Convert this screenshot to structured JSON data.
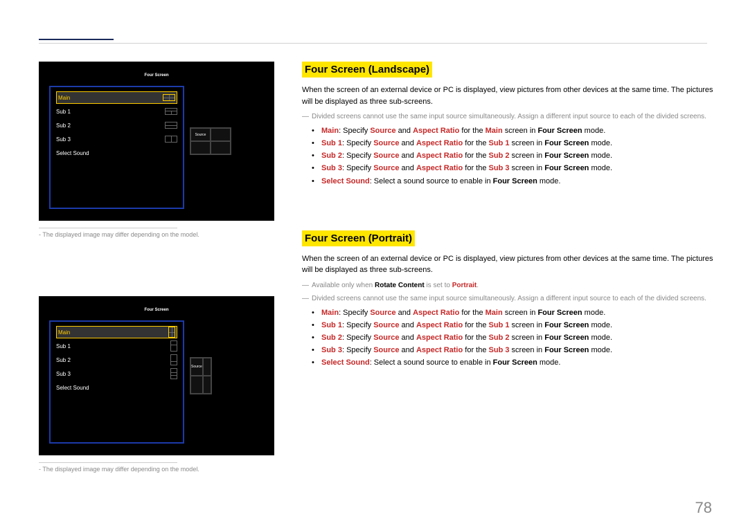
{
  "pageNumber": "78",
  "caption": "The displayed image may differ depending on the model.",
  "osd": {
    "tabActive": "Four Screen",
    "tabActive2": "Four Screen",
    "rows": {
      "landscape": [
        {
          "label": "Main",
          "sel": true,
          "glyph": "four-land"
        },
        {
          "label": "Sub 1",
          "glyph": "gL1"
        },
        {
          "label": "Sub 2",
          "glyph": "gL2"
        },
        {
          "label": "Sub 3",
          "glyph": "gL3"
        },
        {
          "label": "Select Sound",
          "value": ""
        }
      ],
      "portrait": [
        {
          "label": "Main",
          "sel": true,
          "glyph": "four-port-sel",
          "portrait": true
        },
        {
          "label": "Sub 1",
          "glyph": "gP1",
          "portrait": true
        },
        {
          "label": "Sub 2",
          "glyph": "gP2",
          "portrait": true
        },
        {
          "label": "Sub 3",
          "glyph": "gP3",
          "portrait": true
        },
        {
          "label": "Select Sound",
          "value": ""
        }
      ]
    },
    "previewLabel": "Source"
  },
  "section1": {
    "title": "Four Screen (Landscape)",
    "intro": "When the screen of an external device or PC is displayed, view pictures from other devices at the same time. The pictures will be displayed as three sub-screens.",
    "note1": "Divided screens cannot use the same input source simultaneously. Assign a different input source to each of the divided screens.",
    "bullets": [
      {
        "lead": "Main",
        "t1": ": Specify ",
        "b1": "Source",
        "t2": " and ",
        "b2": "Aspect Ratio",
        "t3": " for the ",
        "b3": "Main",
        "t4": " screen in ",
        "b4": "Four Screen",
        "t5": " mode."
      },
      {
        "lead": "Sub 1",
        "t1": ": Specify ",
        "b1": "Source",
        "t2": " and ",
        "b2": "Aspect Ratio",
        "t3": " for the ",
        "b3": "Sub 1",
        "t4": " screen in ",
        "b4": "Four Screen",
        "t5": " mode."
      },
      {
        "lead": "Sub 2",
        "t1": ": Specify ",
        "b1": "Source",
        "t2": " and ",
        "b2": "Aspect Ratio",
        "t3": " for the ",
        "b3": "Sub 2",
        "t4": " screen in ",
        "b4": "Four Screen",
        "t5": " mode."
      },
      {
        "lead": "Sub 3",
        "t1": ": Specify ",
        "b1": "Source",
        "t2": " and ",
        "b2": "Aspect Ratio",
        "t3": " for the ",
        "b3": "Sub 3",
        "t4": " screen in ",
        "b4": "Four Screen",
        "t5": " mode."
      },
      {
        "lead": "Select Sound",
        "t1": ": Select a sound source to enable in ",
        "b1": "Four Screen",
        "t2": " mode."
      }
    ]
  },
  "section2": {
    "title": "Four Screen (Portrait)",
    "intro": "When the screen of an external device or PC is displayed, view pictures from other devices at the same time. The pictures will be displayed as three sub-screens.",
    "noteA_pre": "Available only when ",
    "noteA_b1": "Rotate Content",
    "noteA_mid": " is set to ",
    "noteA_b2": "Portrait",
    "noteA_suf": ".",
    "note1": "Divided screens cannot use the same input source simultaneously. Assign a different input source to each of the divided screens.",
    "bullets": [
      {
        "lead": "Main",
        "t1": ": Specify ",
        "b1": "Source",
        "t2": " and ",
        "b2": "Aspect Ratio",
        "t3": " for the ",
        "b3": "Main",
        "t4": " screen in ",
        "b4": "Four Screen",
        "t5": " mode."
      },
      {
        "lead": "Sub 1",
        "t1": ": Specify ",
        "b1": "Source",
        "t2": " and ",
        "b2": "Aspect Ratio",
        "t3": " for the ",
        "b3": "Sub 1",
        "t4": " screen in ",
        "b4": "Four Screen",
        "t5": " mode."
      },
      {
        "lead": "Sub 2",
        "t1": ": Specify ",
        "b1": "Source",
        "t2": " and ",
        "b2": "Aspect Ratio",
        "t3": " for the ",
        "b3": "Sub 2",
        "t4": " screen in ",
        "b4": "Four Screen",
        "t5": " mode."
      },
      {
        "lead": "Sub 3",
        "t1": ": Specify ",
        "b1": "Source",
        "t2": " and ",
        "b2": "Aspect Ratio",
        "t3": " for the ",
        "b3": "Sub 3",
        "t4": " screen in ",
        "b4": "Four Screen",
        "t5": " mode."
      },
      {
        "lead": "Select Sound",
        "t1": ": Select a sound source to enable in ",
        "b1": "Four Screen",
        "t2": " mode."
      }
    ]
  }
}
